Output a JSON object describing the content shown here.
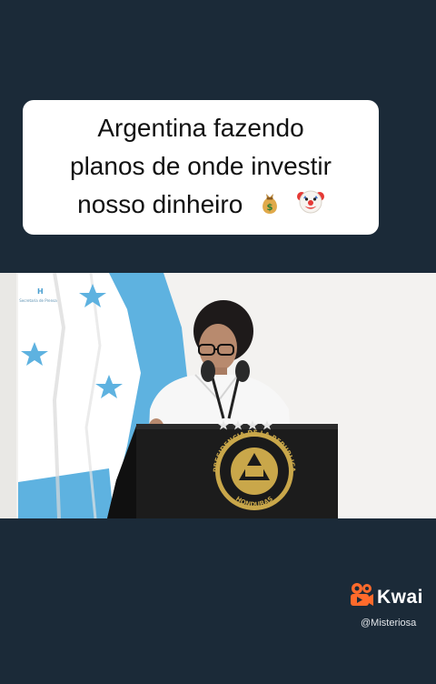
{
  "caption": {
    "lines": [
      "Argentina fazendo",
      "planos de onde investir",
      "nosso dinheiro"
    ],
    "emojis": [
      "money-bag-icon",
      "clown-face-icon"
    ]
  },
  "video": {
    "description_icons": [
      "honduras-flag",
      "podium",
      "presidential-seal"
    ],
    "seal_text": "PRESIDENCIA DE LA REPUBLICA",
    "seal_bottom_text": "HONDURAS",
    "corner_logo_text": "Secretaría de Prensa",
    "colors": {
      "flag_blue": "#5eb2e0",
      "podium": "#1c1c1c",
      "seal_gold": "#c9a74a"
    }
  },
  "watermark": {
    "brand": "Kwai",
    "username": "@Misteriosa",
    "accent_color": "#ff6a2b"
  }
}
